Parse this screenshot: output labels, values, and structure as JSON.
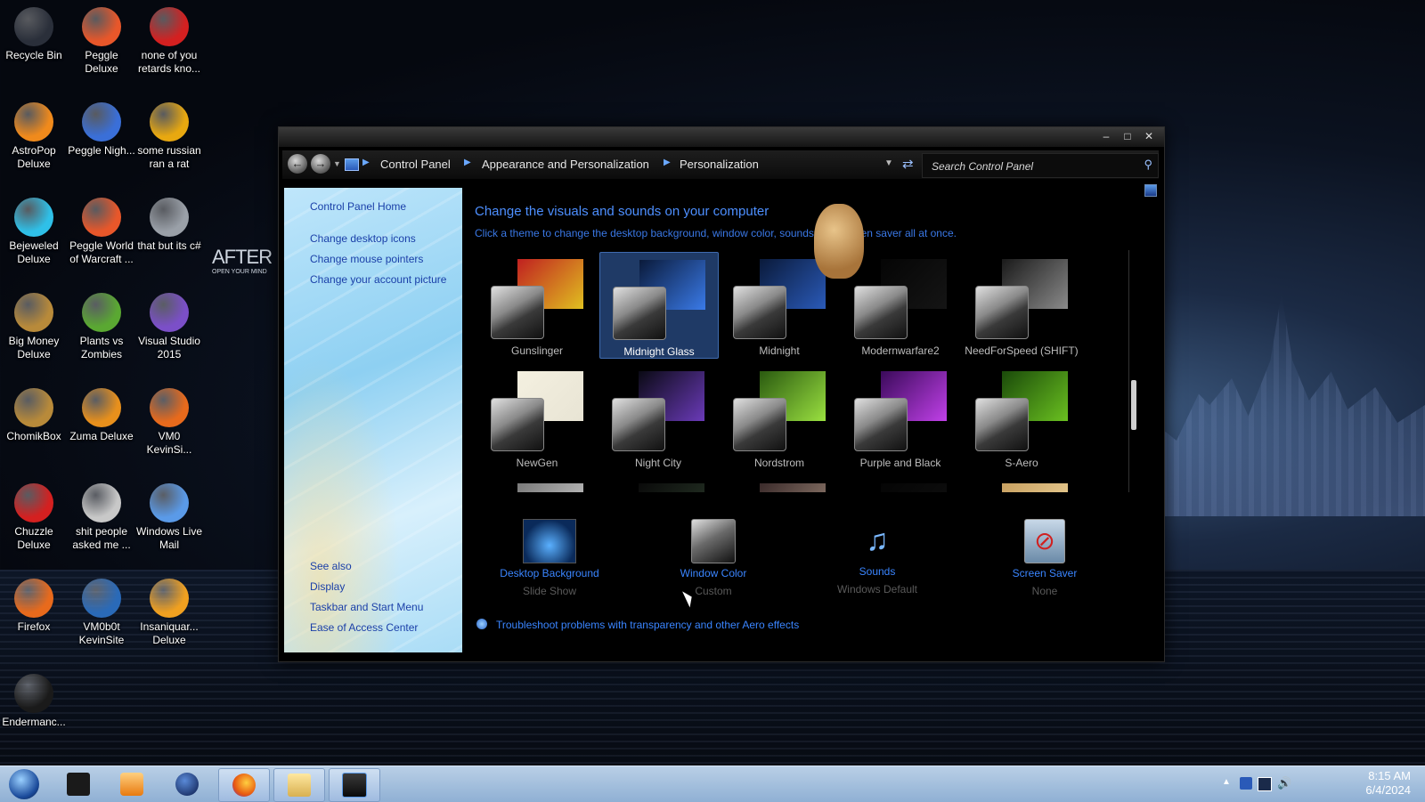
{
  "desktop": {
    "icons": [
      {
        "label": "Recycle Bin",
        "icon": "recycle-bin-icon",
        "color": "#2a2f3a"
      },
      {
        "label": "Peggle Deluxe",
        "icon": "peggle-icon",
        "color": "#e8572a"
      },
      {
        "label": "none of you retards kno...",
        "icon": "red-bird-icon",
        "color": "#d42020"
      },
      {
        "label": "AstroPop Deluxe",
        "icon": "astropop-icon",
        "color": "#f08a1c"
      },
      {
        "label": "Peggle Nigh...",
        "icon": "peggle-nights-icon",
        "color": "#3a6fd8"
      },
      {
        "label": "some russian ran a rat",
        "icon": "de-icon",
        "color": "#e8a810"
      },
      {
        "label": "Bejeweled Deluxe",
        "icon": "diamond-icon",
        "color": "#2fc0e8"
      },
      {
        "label": "Peggle World of Warcraft ...",
        "icon": "peggle-wow-icon",
        "color": "#e8572a"
      },
      {
        "label": "that but its c#",
        "icon": "copy-icon",
        "color": "#9aa0a8"
      },
      {
        "label": "Big Money Deluxe",
        "icon": "money-bag-icon",
        "color": "#b88a3a"
      },
      {
        "label": "Plants vs Zombies",
        "icon": "plant-icon",
        "color": "#5aa832"
      },
      {
        "label": "Visual Studio 2015",
        "icon": "visual-studio-icon",
        "color": "#7b4fc8"
      },
      {
        "label": "ChomikBox",
        "icon": "chomik-icon",
        "color": "#b88a3a"
      },
      {
        "label": "Zuma Deluxe",
        "icon": "zuma-icon",
        "color": "#e8901c"
      },
      {
        "label": "VM0 KevinSi...",
        "icon": "firefox-doc-icon",
        "color": "#e86a1c"
      },
      {
        "label": "Chuzzle Deluxe",
        "icon": "chuzzle-icon",
        "color": "#d42020"
      },
      {
        "label": "shit people asked me ...",
        "icon": "document-icon",
        "color": "#c8c8c8"
      },
      {
        "label": "Windows Live Mail",
        "icon": "mail-icon",
        "color": "#5a9ae8"
      },
      {
        "label": "Firefox",
        "icon": "firefox-icon",
        "color": "#e86a1c"
      },
      {
        "label": "VM0b0t KevinSite",
        "icon": "vm-icon",
        "color": "#2a6ab8"
      },
      {
        "label": "Insaniquar... Deluxe",
        "icon": "fish-icon",
        "color": "#f0a020"
      },
      {
        "label": "Endermanc...",
        "icon": "terminal-icon",
        "color": "#1a1a1a"
      }
    ],
    "logo_text": "AFTER M",
    "logo_sub": "OPEN YOUR MIND"
  },
  "window": {
    "nav": {
      "back": "back",
      "forward": "forward"
    },
    "breadcrumb": [
      "Control Panel",
      "Appearance and Personalization",
      "Personalization"
    ],
    "search_placeholder": "Search Control Panel",
    "sidebar": {
      "links": [
        "Control Panel Home",
        "Change desktop icons",
        "Change mouse pointers",
        "Change your account picture"
      ],
      "see_also_title": "See also",
      "see_also": [
        "Display",
        "Taskbar and Start Menu",
        "Ease of Access Center"
      ]
    },
    "main": {
      "heading": "Change the visuals and sounds on your computer",
      "subheading": "Click a theme to change the desktop background, window color, sounds, and screen saver all at once.",
      "themes": [
        {
          "name": "Gunslinger",
          "colors": [
            "#c02020",
            "#e0c020"
          ]
        },
        {
          "name": "Midnight Glass",
          "colors": [
            "#0a1a3a",
            "#3a7ae8"
          ],
          "selected": true
        },
        {
          "name": "Midnight",
          "colors": [
            "#0a1a3a",
            "#2a5ab8"
          ]
        },
        {
          "name": "Modernwarfare2",
          "colors": [
            "#050505",
            "#151515"
          ]
        },
        {
          "name": "NeedForSpeed (SHIFT)",
          "colors": [
            "#1a1a1a",
            "#8a8a8a"
          ]
        },
        {
          "name": "NewGen",
          "colors": [
            "#f4f0e0",
            "#e8e4d4"
          ]
        },
        {
          "name": "Night City",
          "colors": [
            "#0a0a14",
            "#6a3ab8"
          ]
        },
        {
          "name": "Nordstrom",
          "colors": [
            "#2a5a10",
            "#9ae040"
          ]
        },
        {
          "name": "Purple and Black",
          "colors": [
            "#3a0a5a",
            "#c040e8"
          ]
        },
        {
          "name": "S-Aero",
          "colors": [
            "#1a4a0a",
            "#6ac020"
          ]
        },
        {
          "name": "",
          "colors": [
            "#7a7a7a",
            "#d0d0d0"
          ]
        },
        {
          "name": "",
          "colors": [
            "#0a0a0a",
            "#2a3a2a"
          ]
        },
        {
          "name": "",
          "colors": [
            "#3a2a2a",
            "#a08a7a"
          ]
        },
        {
          "name": "",
          "colors": [
            "#050505",
            "#101010"
          ]
        },
        {
          "name": "",
          "colors": [
            "#c8a060",
            "#f0d8a0"
          ]
        }
      ],
      "options": [
        {
          "label": "Desktop Background",
          "value": "Slide Show",
          "icon": "desktop-background-icon"
        },
        {
          "label": "Window Color",
          "value": "Custom",
          "icon": "window-color-icon"
        },
        {
          "label": "Sounds",
          "value": "Windows Default",
          "icon": "sounds-icon"
        },
        {
          "label": "Screen Saver",
          "value": "None",
          "icon": "screen-saver-icon"
        }
      ],
      "troubleshoot": "Troubleshoot problems with transparency and other Aero effects"
    }
  },
  "taskbar": {
    "time": "8:15 AM",
    "date": "6/4/2024"
  }
}
